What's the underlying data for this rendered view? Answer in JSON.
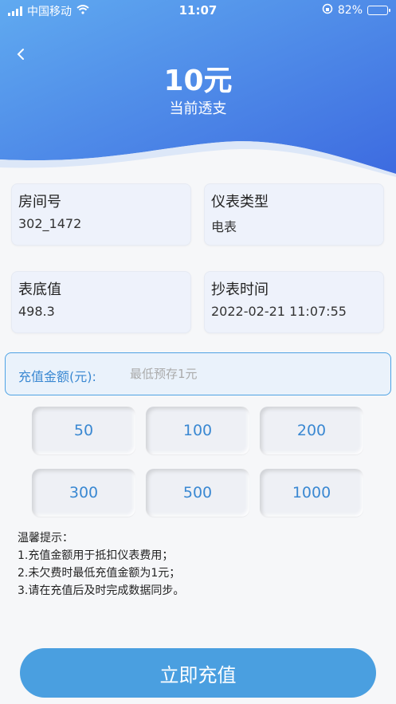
{
  "status_bar": {
    "carrier": "中国移动",
    "time": "11:07",
    "battery": "82%",
    "battery_level": 0.82
  },
  "header": {
    "amount": "10元",
    "subtitle": "当前透支",
    "gradient_start": "#5fa9ee",
    "gradient_end": "#3e6ee0"
  },
  "info": {
    "room": {
      "label": "房间号",
      "value": "302_1472"
    },
    "meter_type": {
      "label": "仪表类型",
      "value": "电表"
    },
    "base_value": {
      "label": "表底值",
      "value": "498.3"
    },
    "read_time": {
      "label": "抄表时间",
      "value": "2022-02-21 11:07:55"
    }
  },
  "recharge": {
    "label": "充值金额(元):",
    "placeholder": "最低预存1元",
    "options": [
      "50",
      "100",
      "200",
      "300",
      "500",
      "1000"
    ]
  },
  "tips": {
    "title": "温馨提示：",
    "lines": [
      "1.充值金额用于抵扣仪表费用；",
      "2.未欠费时最低充值金额为1元；",
      "3.请在充值后及时完成数据同步。"
    ]
  },
  "submit_label": "立即充值",
  "colors": {
    "accent": "#4a9fe0",
    "label_blue": "#3a88d2"
  },
  "icons": [
    "signal-icon",
    "wifi-icon",
    "orientation-lock-icon",
    "battery-icon",
    "back-arrow-icon"
  ]
}
